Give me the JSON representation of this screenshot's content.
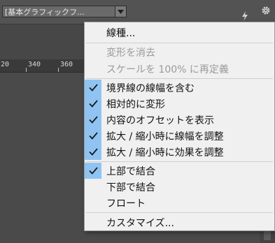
{
  "toolbar": {
    "style_select_value": "[基本グラフィックフ..."
  },
  "ruler": {
    "labels": [
      "20",
      "340",
      "360"
    ]
  },
  "menu": {
    "stroke_type": "線種...",
    "clear_transform": "変形を消去",
    "redefine_scale": "スケールを 100% に再定義",
    "include_stroke_weight": "境界線の線幅を含む",
    "transform_relative": "相対的に変形",
    "show_content_offset": "内容のオフセットを表示",
    "adjust_stroke_on_scale": "拡大 / 縮小時に線幅を調整",
    "adjust_effects_on_scale": "拡大 / 縮小時に効果を調整",
    "dock_top": "上部で結合",
    "dock_bottom": "下部で結合",
    "float": "フロート",
    "customize": "カスタマイズ..."
  },
  "colors": {
    "check_highlight": "#8fc4f2",
    "menu_background": "#f0f0f0",
    "disabled_text": "#9a9a9a"
  }
}
